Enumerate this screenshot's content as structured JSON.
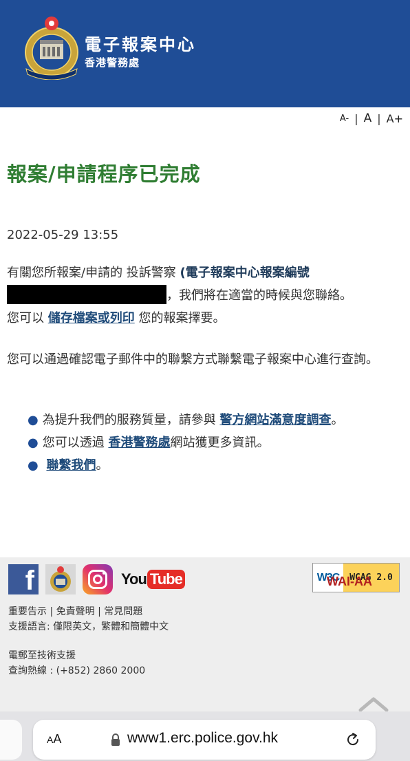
{
  "header": {
    "title": "電子報案中心",
    "subtitle": "香港警務處",
    "logo_icon": "hong-kong-police-badge-icon",
    "bg_color": "#1f4d96"
  },
  "font_size_switch": {
    "small": "A-",
    "medium": "A",
    "large": "A+"
  },
  "main": {
    "title": "報案/申請程序已完成",
    "title_color": "#2f7d32",
    "timestamp": "2022-05-29 13:55",
    "para1": {
      "prefix": "有關您所報案/申請的 投訴警察 ",
      "ref_label": "(電子報案中心報案編號",
      "after_redact": "，我們將在適當的時候與您聯絡。",
      "save_prefix": "您可以 ",
      "save_link": "儲存檔案或列印",
      "save_suffix": " 您的報案擇要。"
    },
    "para2": "您可以通過確認電子郵件中的聯繫方式聯繫電子報案中心進行查詢。",
    "bullets": {
      "b1_prefix": "為提升我們的服務質量，請參與 ",
      "b1_link": "警方網站滿意度調查",
      "b1_suffix": "。",
      "b2_prefix": "您可以透過 ",
      "b2_link": "香港警務處",
      "b2_suffix": "網站獲更多資訊。",
      "b3_link": "聯繫我們",
      "b3_suffix": "。"
    }
  },
  "footer": {
    "social": {
      "facebook": "f",
      "youtube_you": "You",
      "youtube_tube": "Tube"
    },
    "w3c": {
      "logo": "W3C",
      "line1": "WAI-AA",
      "line2": "WCAG 2.0"
    },
    "links": {
      "notice": "重要告示",
      "disclaimer": "免責聲明",
      "faq": "常見問題",
      "sep": " | "
    },
    "languages": "支援語言: 僅限英文，繁體和簡體中文",
    "tech_support": "電郵至技術支援",
    "hotline": "查詢熱線 : (+852) 2860 2000"
  },
  "browser": {
    "aa_big": "A",
    "aa_small": "A",
    "url": "www1.erc.police.gov.hk"
  }
}
